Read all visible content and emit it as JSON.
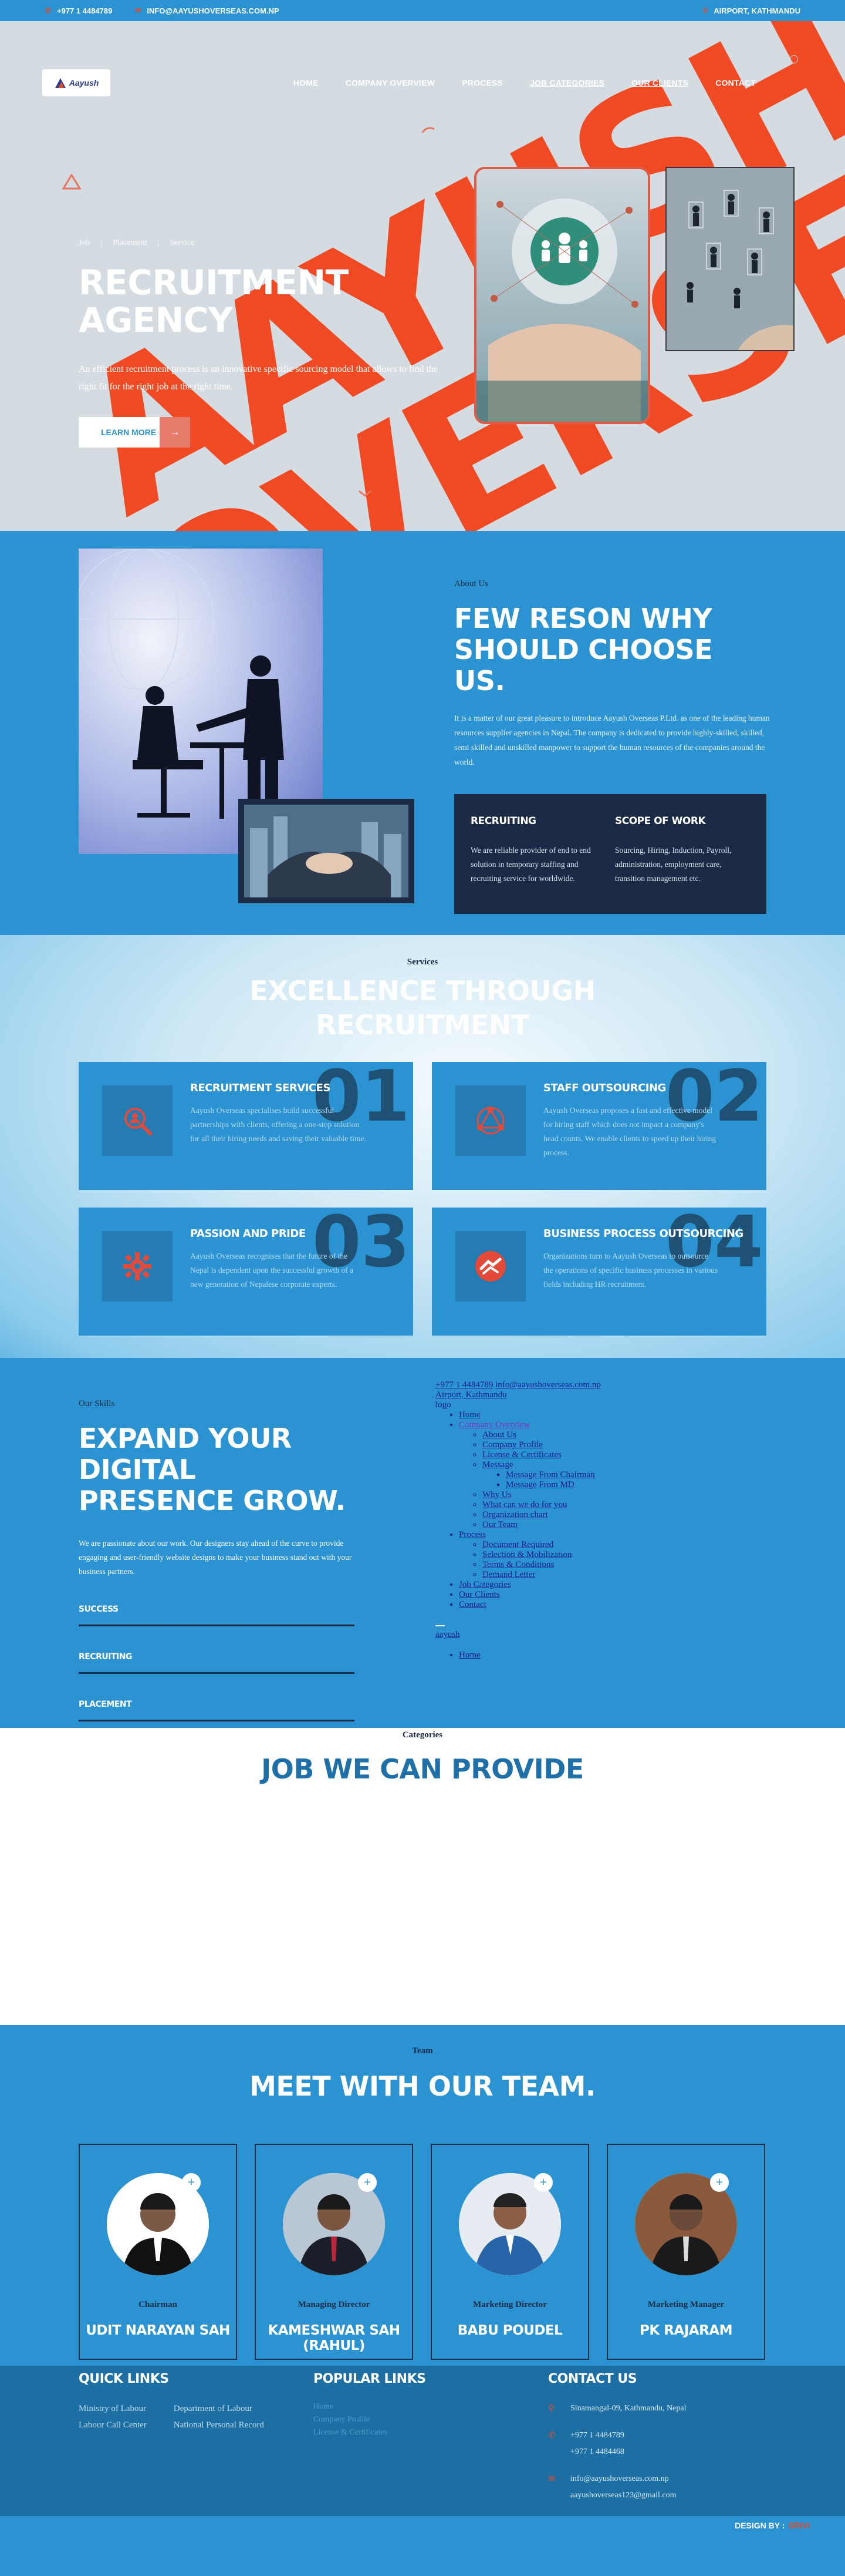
{
  "topbar": {
    "phone": "+977 1 4484789",
    "email": "INFO@AAYUSHOVERSEAS.COM.NP",
    "location": "AIRPORT, KATHMANDU"
  },
  "brand": {
    "logo_text": "Aayush",
    "watermark": "AAYUSH OVERSEAS"
  },
  "nav": {
    "items": [
      "HOME",
      "COMPANY OVERVIEW",
      "PROCESS",
      "JOB CATEGORIES",
      "OUR CLIENTS",
      "CONTACT"
    ]
  },
  "hero": {
    "crumbs": [
      "Job",
      "Placement",
      "Service"
    ],
    "title": "RECRUITMENT AGENCY",
    "desc": "An efficient recruitment process is an innovative specific sourcing model that allows to find the right fit for the right job at the right time.",
    "button": "LEARN MORE"
  },
  "about": {
    "eyebrow": "About Us",
    "title": "FEW RESON WHY SHOULD CHOOSE US.",
    "paragraph": "It is a matter of our great pleasure to introduce Aayush Overseas P.Ltd. as one of the leading human resources supplier agencies in Nepal. The company is dedicated to provide highly-skilled, skilled, semi skilled and unskilled manpower to support the human resources of the companies around the world.",
    "boxes": [
      {
        "title": "RECRUITING",
        "text": "We are reliable provider of end to end solution in temporary staffing and recruiting service for worldwide."
      },
      {
        "title": "SCOPE OF WORK",
        "text": "Sourcing, Hiring, Induction, Payroll, administration, employment care, transition management etc."
      }
    ]
  },
  "services": {
    "eyebrow": "Services",
    "title_line1": "EXCELLENCE THROUGH",
    "title_line2": "RECRUITMENT",
    "cards": [
      {
        "num": "01",
        "title": "RECRUITMENT SERVICES",
        "text": "Aayush Overseas specialises build successful partnerships with clients, offering a one-stop solution for all their hiring needs and saving their valuable time."
      },
      {
        "num": "02",
        "title": "STAFF OUTSOURCING",
        "text": "Aayush Overseas proposes a fast and effective model for hiring staff which does not impact a company's head counts. We enable clients to speed up their hiring process."
      },
      {
        "num": "03",
        "title": "PASSION AND PRIDE",
        "text": "Aayush Overseas recognises that the future of the Nepal is dependent upon the successful growth of a new generation of Nepalese corporate experts."
      },
      {
        "num": "04",
        "title": "BUSINESS PROCESS OUTSOURCING",
        "text": "Organizations turn to Aayush Overseas to outsource the operations of specific business processes in various fields including HR recruitment."
      }
    ]
  },
  "skills": {
    "eyebrow": "Our Skills",
    "title": "EXPAND YOUR DIGITAL PRESENCE GROW.",
    "paragraph": "We are passionate about our work. Our designers stay ahead of the curve to provide engaging and user-friendly website designs to make your business stand out with your business partners.",
    "bars": [
      "SUCCESS",
      "RECRUITING",
      "PLACEMENT"
    ]
  },
  "fallback_menu": {
    "phone": "+977 1 4484789",
    "email": "info@aayushoverseas.com.np",
    "location": "Airport, Kathmandu",
    "logo_alt": "logo",
    "items": [
      {
        "label": "Home"
      },
      {
        "label": "Company Overview",
        "children": [
          {
            "label": "About Us"
          },
          {
            "label": "Company Profile"
          },
          {
            "label": "License & Certificates"
          },
          {
            "label": "Message",
            "children": [
              {
                "label": "Message From Chairman"
              },
              {
                "label": "Message From MD"
              }
            ]
          },
          {
            "label": "Why Us"
          },
          {
            "label": "What can we do for you"
          },
          {
            "label": "Organization chart"
          },
          {
            "label": "Our Team"
          }
        ]
      },
      {
        "label": "Process",
        "children": [
          {
            "label": "Document Required"
          },
          {
            "label": "Selection & Mobilization"
          },
          {
            "label": "Terms & Conditions"
          },
          {
            "label": "Demand Letter"
          }
        ]
      },
      {
        "label": "Job Categories"
      },
      {
        "label": "Our Clients"
      },
      {
        "label": "Contact"
      }
    ],
    "mobile_logo": "aayush",
    "mobile_home": "Home"
  },
  "categories": {
    "eyebrow": "Categories",
    "title": "JOB WE CAN PROVIDE"
  },
  "team": {
    "eyebrow": "Team",
    "title": "MEET WITH OUR TEAM.",
    "members": [
      {
        "role": "Chairman",
        "name": "UDIT NARAYAN SAH"
      },
      {
        "role": "Managing Director",
        "name": "KAMESHWAR SAH (RAHUL)"
      },
      {
        "role": "Marketing Director",
        "name": "BABU POUDEL"
      },
      {
        "role": "Marketing Manager",
        "name": "PK RAJARAM"
      }
    ]
  },
  "footer": {
    "quick_title": "QUICK LINKS",
    "quick_col1": [
      "Ministry of Labour",
      "Labour Call Center"
    ],
    "quick_col2": [
      "Department of Labour",
      "National Personal Record"
    ],
    "popular_title": "POPULAR LINKS",
    "popular": [
      "Home",
      "Company Profile",
      "License & Certificates"
    ],
    "contact_title": "CONTACT US",
    "address": "Sinamangal-09, Kathmandu, Nepal",
    "phone1": "+977 1 4484789",
    "phone2": "+977 1 4484468",
    "email1": "info@aayushoverseas.com.np",
    "email2": "aayushoverseas123@gmail.com",
    "design_by": "DESIGN BY :",
    "designer": "SRIVI"
  },
  "colors": {
    "primary": "#2b93d1",
    "dark": "#1c2b45",
    "accent": "#e04b2a"
  }
}
